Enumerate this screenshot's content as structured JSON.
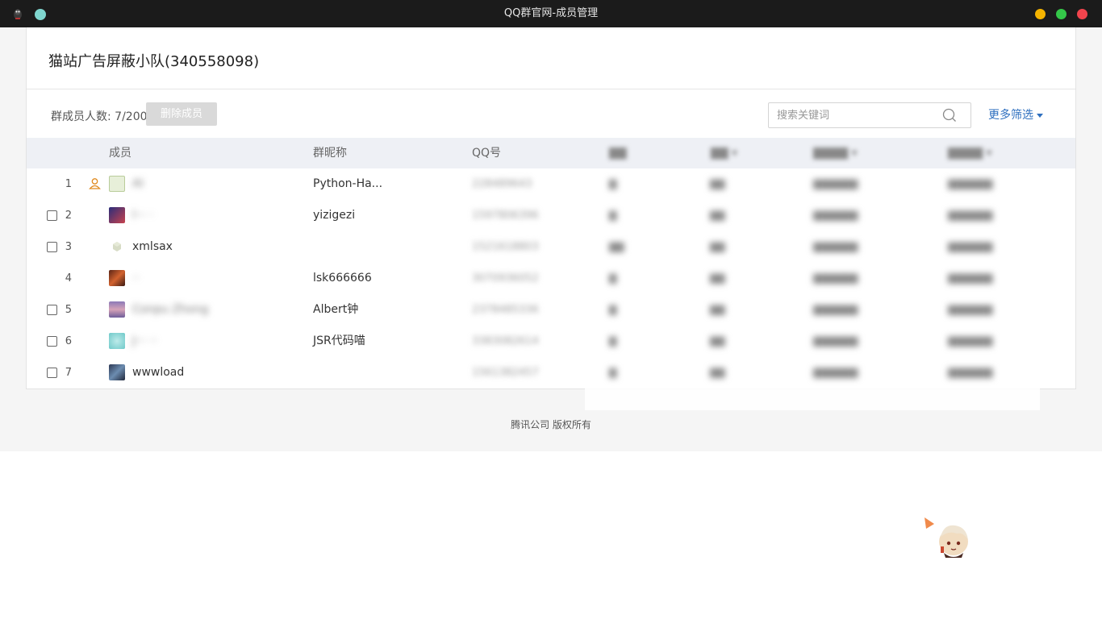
{
  "window": {
    "title": "QQ群官网-成员管理"
  },
  "group": {
    "title": "猫站广告屏蔽小队(340558098)"
  },
  "toolbar": {
    "member_count": "群成员人数: 7/200",
    "delete_label": "删除成员",
    "search_placeholder": "搜索关键词",
    "more_filter": "更多筛选"
  },
  "table": {
    "headers": {
      "member": "成员",
      "nickname": "群昵称",
      "qq": "QQ号"
    },
    "rows": [
      {
        "index": "1",
        "member": "AI",
        "nickname": "Python-Ha...",
        "qq": "228489643",
        "is_owner": true
      },
      {
        "index": "2",
        "member": "l··· ·",
        "nickname": "yizigezi",
        "qq": "1597806396",
        "is_owner": false
      },
      {
        "index": "3",
        "member": "xmlsax",
        "nickname": "",
        "qq": "1521618803",
        "is_owner": false
      },
      {
        "index": "4",
        "member": "··",
        "nickname": "lsk666666",
        "qq": "3070936052",
        "is_owner": false
      },
      {
        "index": "5",
        "member": "Conpu Zhong",
        "nickname": "Albert钟",
        "qq": "2378485336",
        "is_owner": false
      },
      {
        "index": "6",
        "member": "J··· ··",
        "nickname": "JSR代码喵",
        "qq": "3383082614",
        "is_owner": false
      },
      {
        "index": "7",
        "member": "wwwload",
        "nickname": "",
        "qq": "1561382457",
        "is_owner": false
      }
    ],
    "member_blurred": [
      true,
      true,
      false,
      true,
      true,
      true,
      false
    ]
  },
  "footer": {
    "text": "腾讯公司 版权所有"
  },
  "colors": {
    "titlebar": "#1b1b1b",
    "link": "#2e6fbf",
    "header_bg": "#eef0f5"
  }
}
